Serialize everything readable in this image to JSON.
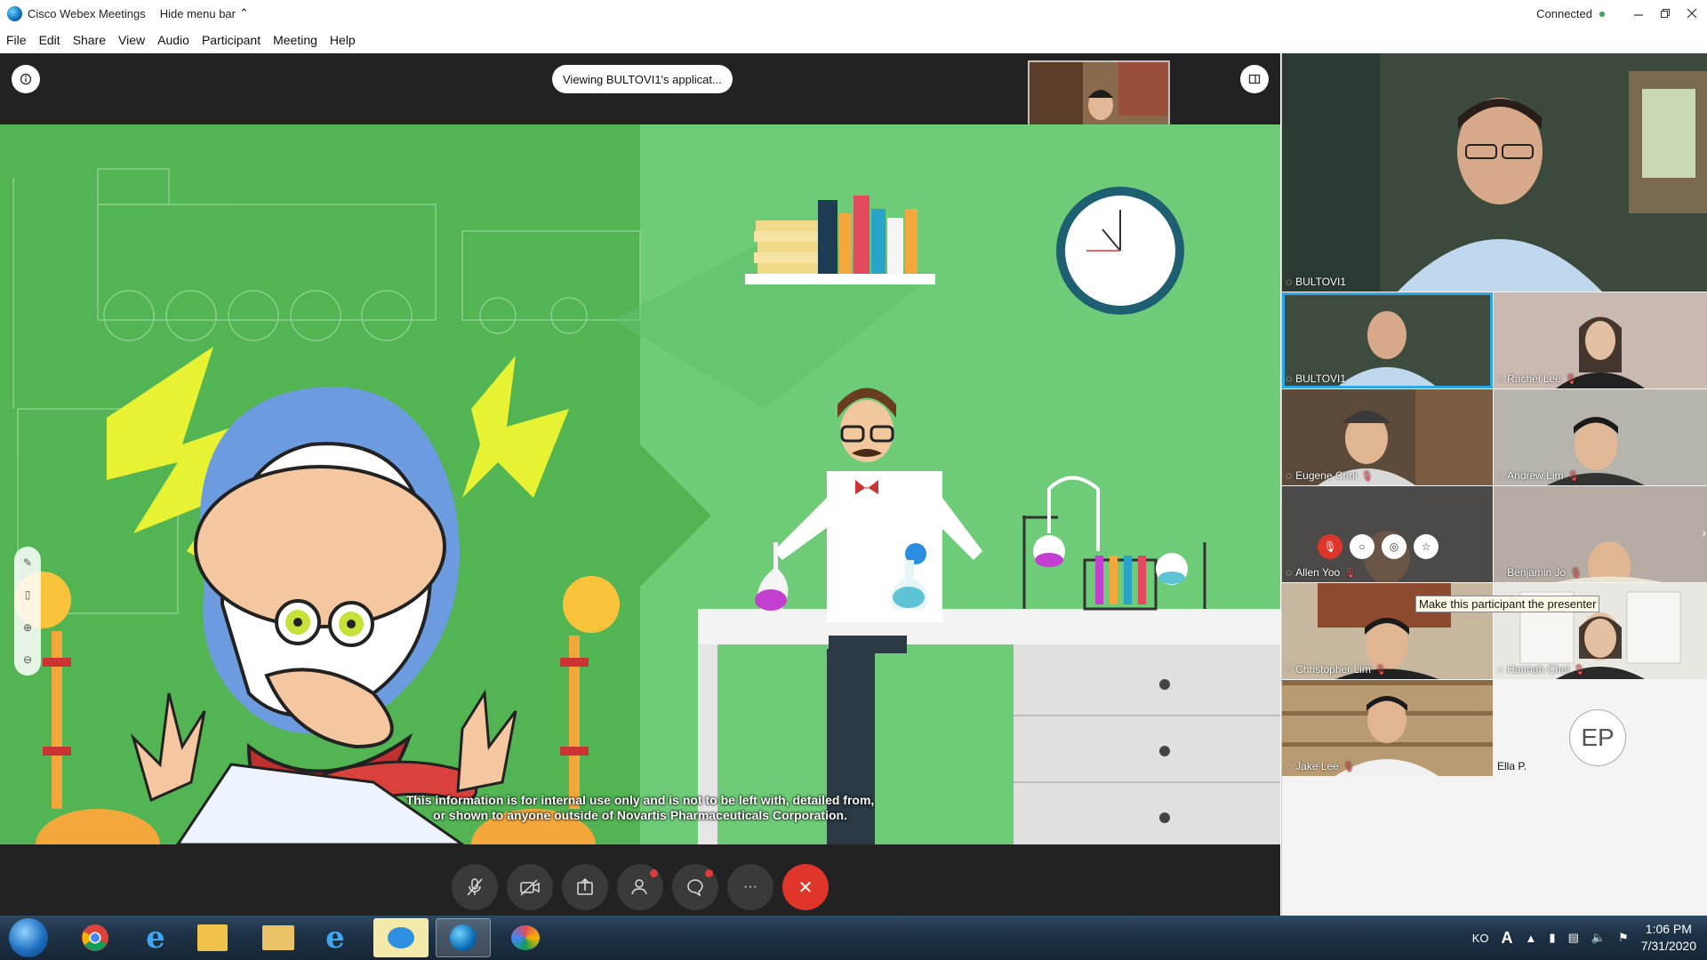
{
  "window": {
    "title": "Cisco Webex Meetings",
    "hide_menu": "Hide menu bar",
    "connection": "Connected"
  },
  "menu": [
    "File",
    "Edit",
    "Share",
    "View",
    "Audio",
    "Participant",
    "Meeting",
    "Help"
  ],
  "stage": {
    "viewing_label": "Viewing BULTOVI1's applicat...",
    "disclaimer_line1": "This information is for internal use only and is not to be left with, detailed from,",
    "disclaimer_line2": "or shown to anyone outside of Novartis Pharmaceuticals Corporation."
  },
  "controls": {
    "mute": {
      "icon": "mic-muted-icon"
    },
    "video": {
      "icon": "video-off-icon"
    },
    "share": {
      "icon": "share-icon"
    },
    "participants": {
      "icon": "participants-icon"
    },
    "chat": {
      "icon": "chat-icon"
    },
    "more": {
      "icon": "more-icon",
      "glyph": "···"
    },
    "end": {
      "icon": "end-call-icon",
      "glyph": "✕"
    }
  },
  "participants": {
    "active_speaker": "BULTOVI1",
    "grid": [
      {
        "name": "BULTOVI1",
        "muted": false
      },
      {
        "name": "Rachel Lee",
        "muted": true
      },
      {
        "name": "Eugene Choi",
        "muted": true
      },
      {
        "name": "Andrew Lim",
        "muted": true
      },
      {
        "name": "Allen Yoo",
        "muted": true
      },
      {
        "name": "Benjamin Jo",
        "muted": true
      },
      {
        "name": "Christopher Lim",
        "muted": true
      },
      {
        "name": "Hannah Choi",
        "muted": true
      },
      {
        "name": "Jake Lee",
        "muted": true
      },
      {
        "name": "Ella P.",
        "muted": false,
        "initials": "EP"
      }
    ],
    "tooltip": "Make this participant the presenter"
  },
  "taskbar": {
    "lang": "KO",
    "time": "1:06 PM",
    "date": "7/31/2020"
  },
  "colors": {
    "accent": "#2aa7e8",
    "end": "#e0352b",
    "green_left": "#53b454",
    "green_right": "#6ecc78"
  }
}
